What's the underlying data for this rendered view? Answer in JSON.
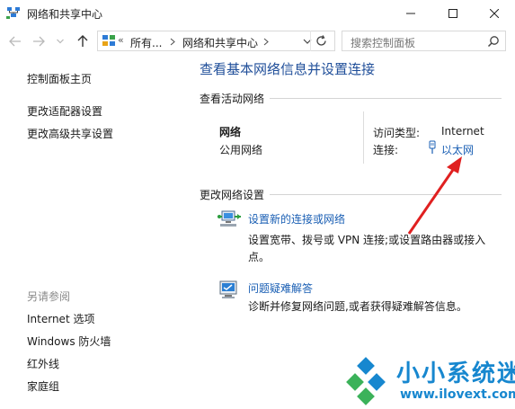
{
  "window": {
    "title": "网络和共享中心"
  },
  "address": {
    "overflow": "«",
    "crumbs": [
      "所有...",
      "网络和共享中心"
    ],
    "search_placeholder": "搜索控制面板"
  },
  "sidebar": {
    "home": "控制面板主页",
    "links": [
      "更改适配器设置",
      "更改高级共享设置"
    ],
    "see_also_label": "另请参阅",
    "see_also": [
      "Internet 选项",
      "Windows 防火墙",
      "红外线",
      "家庭组"
    ]
  },
  "main": {
    "title": "查看基本网络信息并设置连接",
    "active_section": "查看活动网络",
    "network_name": "网络",
    "network_type": "公用网络",
    "access_type_label": "访问类型:",
    "access_type_value": "Internet",
    "connection_label": "连接:",
    "connection_value": "以太网",
    "change_section": "更改网络设置",
    "tasks": [
      {
        "icon": "network-setup-icon",
        "link": "设置新的连接或网络",
        "description": "设置宽带、拨号或 VPN 连接;或设置路由器或接入点。"
      },
      {
        "icon": "troubleshoot-icon",
        "link": "问题疑难解答",
        "description": "诊断并修复网络问题,或者获得疑难解答信息。"
      }
    ]
  },
  "watermark": {
    "title": "小小系统迷",
    "url": "www.ilovext.com"
  },
  "colors": {
    "link": "#1a5fb4",
    "title": "#1f4e99",
    "arrow": "#e02020",
    "watermark": "#1787cf"
  }
}
